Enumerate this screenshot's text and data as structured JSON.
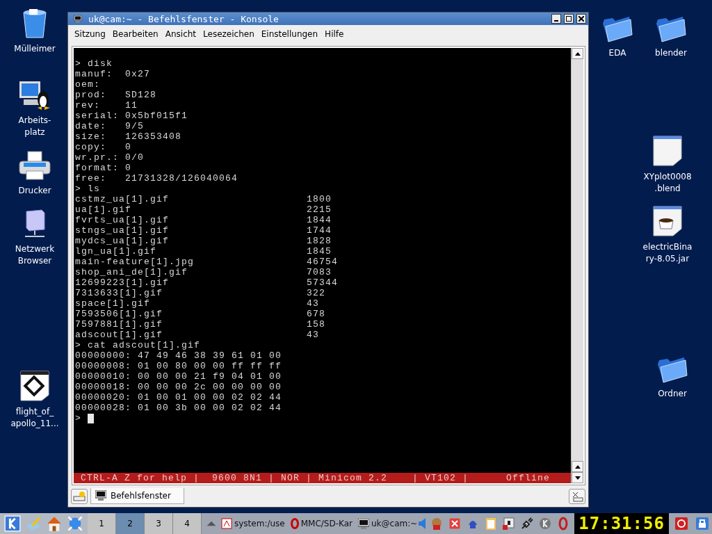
{
  "desktop_icons": [
    {
      "kind": "trash",
      "label": "Mülleimer"
    },
    {
      "kind": "computer",
      "label": "Arbeits-\nplatz"
    },
    {
      "kind": "printer",
      "label": "Drucker"
    },
    {
      "kind": "network",
      "label": "Netzwerk\nBrowser"
    },
    {
      "kind": "video",
      "label": "flight_of_\napollo_11..."
    },
    {
      "kind": "folder",
      "label": "EDA"
    },
    {
      "kind": "folder",
      "label": "blender"
    },
    {
      "kind": "document",
      "label": "XYplot0008\n.blend"
    },
    {
      "kind": "jar",
      "label": "electricBina\nry-8.05.jar"
    },
    {
      "kind": "folder",
      "label": "Ordner"
    }
  ],
  "window": {
    "title": "uk@cam:~ - Befehlsfenster - Konsole",
    "menu": [
      "Sitzung",
      "Bearbeiten",
      "Ansicht",
      "Lesezeichen",
      "Einstellungen",
      "Hilfe"
    ],
    "terminal": {
      "lines": [
        {
          "kind": "text",
          "text": "> disk"
        },
        {
          "kind": "text",
          "text": "manuf:  0x27"
        },
        {
          "kind": "text",
          "text": "oem:"
        },
        {
          "kind": "text",
          "text": "prod:   SD128"
        },
        {
          "kind": "text",
          "text": "rev:    11"
        },
        {
          "kind": "text",
          "text": "serial: 0x5bf015f1"
        },
        {
          "kind": "text",
          "text": "date:   9/5"
        },
        {
          "kind": "text",
          "text": "size:   126353408"
        },
        {
          "kind": "text",
          "text": "copy:   0"
        },
        {
          "kind": "text",
          "text": "wr.pr.: 0/0"
        },
        {
          "kind": "text",
          "text": "format: 0"
        },
        {
          "kind": "text",
          "text": "free:   21731328/126040064"
        },
        {
          "kind": "text",
          "text": "> ls"
        },
        {
          "kind": "file",
          "name": "cstmz_ua[1].gif",
          "size": "1800"
        },
        {
          "kind": "file",
          "name": "ua[1].gif",
          "size": "2215"
        },
        {
          "kind": "file",
          "name": "fvrts_ua[1].gif",
          "size": "1844"
        },
        {
          "kind": "file",
          "name": "stngs_ua[1].gif",
          "size": "1744"
        },
        {
          "kind": "file",
          "name": "mydcs_ua[1].gif",
          "size": "1828"
        },
        {
          "kind": "file",
          "name": "lgn_ua[1].gif",
          "size": "1845"
        },
        {
          "kind": "file",
          "name": "main-feature[1].jpg",
          "size": "46754"
        },
        {
          "kind": "file",
          "name": "shop_ani_de[1].gif",
          "size": "7083"
        },
        {
          "kind": "file",
          "name": "12699223[1].gif",
          "size": "57344"
        },
        {
          "kind": "file",
          "name": "7313633[1].gif",
          "size": "322"
        },
        {
          "kind": "file",
          "name": "space[1].gif",
          "size": "43"
        },
        {
          "kind": "file",
          "name": "7593506[1].gif",
          "size": "678"
        },
        {
          "kind": "file",
          "name": "7597881[1].gif",
          "size": "158"
        },
        {
          "kind": "file",
          "name": "adscout[1].gif",
          "size": "43"
        },
        {
          "kind": "text",
          "text": "> cat adscout[1].gif"
        },
        {
          "kind": "text",
          "text": "00000000: 47 49 46 38 39 61 01 00"
        },
        {
          "kind": "text",
          "text": "00000008: 01 00 80 00 00 ff ff ff"
        },
        {
          "kind": "text",
          "text": "00000010: 00 00 00 21 f9 04 01 00"
        },
        {
          "kind": "text",
          "text": "00000018: 00 00 00 2c 00 00 00 00"
        },
        {
          "kind": "text",
          "text": "00000020: 01 00 01 00 00 02 02 44"
        },
        {
          "kind": "text",
          "text": "00000028: 01 00 3b 00 00 02 02 44"
        },
        {
          "kind": "prompt",
          "text": ">"
        }
      ],
      "status": "CTRL-A Z for help |  9600 8N1 | NOR | Minicom 2.2    | VT102 |      Offline"
    },
    "tabs": [
      {
        "label": "Befehlsfenster",
        "selected": true
      }
    ]
  },
  "taskbar": {
    "desktops": [
      {
        "label": "1",
        "selected": false
      },
      {
        "label": "2",
        "selected": true
      },
      {
        "label": "3",
        "selected": false
      },
      {
        "label": "4",
        "selected": false
      }
    ],
    "tasks": [
      {
        "label": "system:/use",
        "kind": "pdf"
      },
      {
        "label": "MMC/SD-Kar",
        "kind": "opera"
      },
      {
        "label": "uk@cam:~",
        "kind": "terminal"
      }
    ],
    "clock": "17:31:56"
  }
}
